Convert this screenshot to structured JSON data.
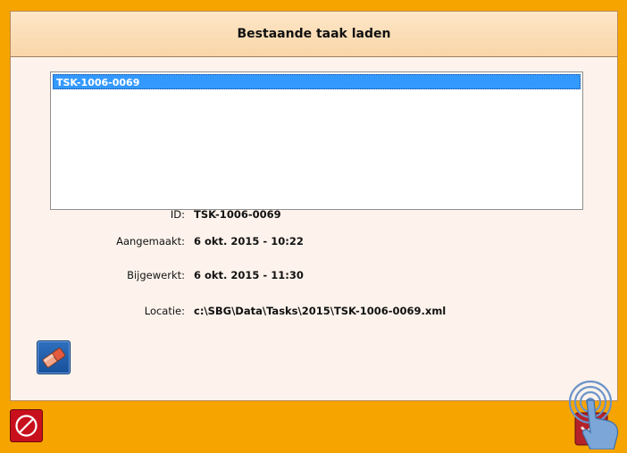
{
  "dialog": {
    "title": "Bestaande taak laden"
  },
  "task_list": {
    "items": [
      "TSK-1006-0069"
    ],
    "selected_index": 0
  },
  "details": {
    "id_label": "ID:",
    "id_value": "TSK-1006-0069",
    "created_label": "Aangemaakt:",
    "created_value": "6 okt. 2015 - 10:22",
    "updated_label": "Bijgewerkt:",
    "updated_value": "6 okt. 2015 - 11:30",
    "location_label": "Locatie:",
    "location_value": "c:\\SBG\\Data\\Tasks\\2015\\TSK-1006-0069.xml"
  },
  "toolbar": {
    "eraser_icon": "eraser-icon",
    "cancel_icon": "prohibited-icon",
    "confirm_icon": "touch-hand-icon"
  },
  "colors": {
    "background": "#f6a400",
    "panel": "#fdf3ec",
    "header": "#fde6c8",
    "selection": "#3399ff",
    "cancel": "#c8101c",
    "eraser_button": "#1f5fae"
  }
}
